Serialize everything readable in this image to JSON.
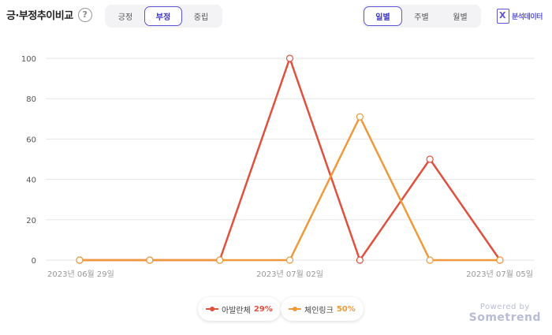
{
  "header": {
    "title": "긍·부정추이비교",
    "help_icon": "?",
    "sentiment_tabs": [
      "긍정",
      "부정",
      "중립"
    ],
    "sentiment_active": 1,
    "period_tabs": [
      "일별",
      "주별",
      "월별"
    ],
    "period_active": 0,
    "analysis_link": "분석데이터"
  },
  "chart_data": {
    "type": "line",
    "x": [
      "2023-06-29",
      "2023-06-30",
      "2023-07-01",
      "2023-07-02",
      "2023-07-03",
      "2023-07-04",
      "2023-07-05"
    ],
    "x_tick_labels": [
      "2023년 06월 29일",
      "2023년 07월 02일",
      "2023년 07월 05일"
    ],
    "x_tick_indices": [
      0,
      3,
      6
    ],
    "ylim": [
      0,
      100
    ],
    "yticks": [
      0,
      20,
      40,
      60,
      80,
      100
    ],
    "grid": true,
    "legend_position": "bottom-center",
    "series": [
      {
        "name": "아발란체",
        "share": "29%",
        "color": "#e0503e",
        "values": [
          0,
          0,
          0,
          100,
          0,
          50,
          0
        ]
      },
      {
        "name": "체인링크",
        "share": "50%",
        "color": "#ee9a3a",
        "values": [
          0,
          0,
          0,
          0,
          71,
          0,
          0
        ]
      }
    ]
  },
  "footer": {
    "powered_by": "Powered by",
    "brand": "Sometrend"
  }
}
